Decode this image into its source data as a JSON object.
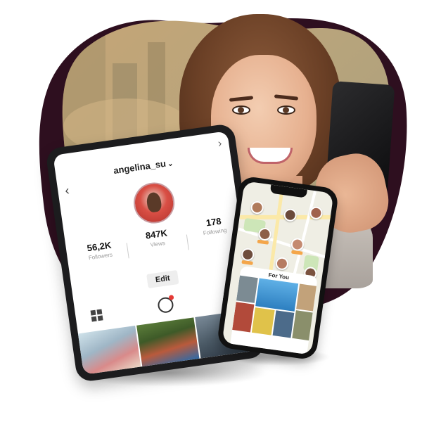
{
  "tablet": {
    "username": "angelina_su",
    "stats": [
      {
        "value": "56,2K",
        "label": "Followers"
      },
      {
        "value": "847K",
        "label": "Views"
      },
      {
        "value": "178",
        "label": "Following"
      }
    ],
    "edit_label": "Edit"
  },
  "phone": {
    "for_you_title": "For You"
  },
  "icons": {
    "back": "chevron-left-icon",
    "forward": "chevron-right-icon",
    "caret": "chevron-down-icon",
    "menu": "hamburger-icon",
    "grid": "grid-icon",
    "chat": "chat-icon",
    "bell": "bell-icon"
  },
  "colors": {
    "blob": "#2e0f1f",
    "notification_dot": "#e53935",
    "map_road": "#fbe9a8"
  }
}
